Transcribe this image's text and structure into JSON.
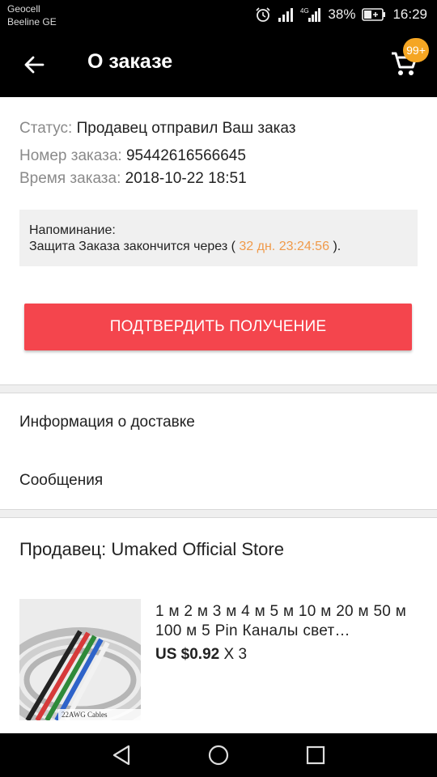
{
  "statusbar": {
    "carrier1": "Geocell",
    "carrier2": "Beeline GE",
    "battery_percent": "38%",
    "time": "16:29"
  },
  "appbar": {
    "title": "О заказе",
    "cart_badge": "99+"
  },
  "order": {
    "status_label": "Статус:",
    "status_value": "Продавец отправил Ваш заказ",
    "number_label": "Номер заказа:",
    "number_value": "95442616566645",
    "time_label": "Время заказа:",
    "time_value": "2018-10-22 18:51",
    "reminder_title": "Напоминание:",
    "reminder_text_before": "Защита Заказа закончится через (",
    "reminder_timer": "32 дн. 23:24:56",
    "reminder_text_after": ").",
    "confirm_button": "ПОДТВЕРДИТЬ ПОЛУЧЕНИЕ"
  },
  "links": {
    "delivery_info": "Информация о доставке",
    "messages": "Сообщения"
  },
  "seller": {
    "label": "Продавец: Umaked Official Store",
    "product": {
      "title": "1 м 2 м 3 м 4 м 5 м 10 м 20 м 50 м 100 м 5 Pin Каналы свет…",
      "price": "US $0.92",
      "quantity": "X 3",
      "image_caption": "22AWG Cables"
    }
  },
  "colors": {
    "accent_red": "#f4454d",
    "timer_orange": "#f09a4a",
    "badge_orange": "#f5a623"
  }
}
